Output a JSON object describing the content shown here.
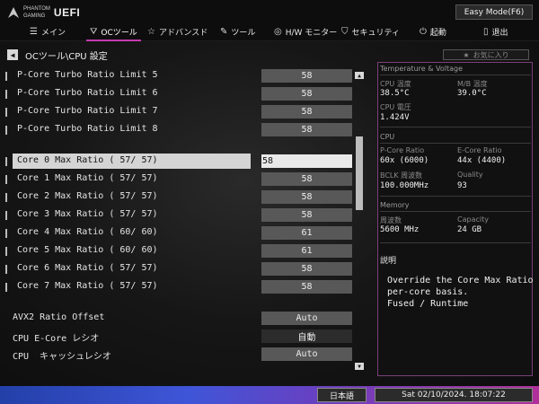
{
  "header": {
    "logo_line1": "PHANTOM",
    "logo_line2": "GAMING",
    "logo_uefi": "UEFI",
    "easy_mode": "Easy Mode(F6)"
  },
  "nav": [
    {
      "icon": "main-icon",
      "label": "メイン"
    },
    {
      "icon": "oc-icon",
      "label": "OCツール"
    },
    {
      "icon": "star-icon",
      "label": "アドバンスド"
    },
    {
      "icon": "tool-icon",
      "label": "ツール"
    },
    {
      "icon": "monitor-icon",
      "label": "H/W モニター"
    },
    {
      "icon": "shield-icon",
      "label": "セキュリティ"
    },
    {
      "icon": "power-icon",
      "label": "起動"
    },
    {
      "icon": "exit-icon",
      "label": "退出"
    }
  ],
  "breadcrumb": "OCツール\\CPU 設定",
  "favorite": "お気に入り",
  "settings": [
    {
      "label": "P-Core Turbo Ratio Limit 5",
      "value": "58"
    },
    {
      "label": "P-Core Turbo Ratio Limit 6",
      "value": "58"
    },
    {
      "label": "P-Core Turbo Ratio Limit 7",
      "value": "58"
    },
    {
      "label": "P-Core Turbo Ratio Limit 8",
      "value": "58"
    },
    {
      "label": "Core 0 Max Ratio ( 57/ 57)",
      "value": "58"
    },
    {
      "label": "Core 1 Max Ratio ( 57/ 57)",
      "value": "58"
    },
    {
      "label": "Core 2 Max Ratio ( 57/ 57)",
      "value": "58"
    },
    {
      "label": "Core 3 Max Ratio ( 57/ 57)",
      "value": "58"
    },
    {
      "label": "Core 4 Max Ratio ( 60/ 60)",
      "value": "61"
    },
    {
      "label": "Core 5 Max Ratio ( 60/ 60)",
      "value": "61"
    },
    {
      "label": "Core 6 Max Ratio ( 57/ 57)",
      "value": "58"
    },
    {
      "label": "Core 7 Max Ratio ( 57/ 57)",
      "value": "58"
    },
    {
      "label": "AVX2 Ratio Offset",
      "value": "Auto"
    },
    {
      "label": "CPU E-Core レシオ",
      "value": "自動"
    },
    {
      "label": "CPU  キャッシュレシオ",
      "value": "Auto"
    }
  ],
  "panel": {
    "section_temp": "Temperature & Voltage",
    "cpu_temp_label": "CPU 温度",
    "cpu_temp": "38.5°C",
    "mb_temp_label": "M/B 温度",
    "mb_temp": "39.0°C",
    "cpu_volt_label": "CPU 電圧",
    "cpu_volt": "1.424V",
    "section_cpu": "CPU",
    "pcore_label": "P-Core Ratio",
    "pcore": "60x (6000)",
    "ecore_label": "E-Core Ratio",
    "ecore": "44x (4400)",
    "bclk_label": "BCLK 周波数",
    "bclk": "100.000MHz",
    "quality_label": "Quality",
    "quality": "93",
    "section_mem": "Memory",
    "freq_label": "周波数",
    "freq": "5600 MHz",
    "cap_label": "Capacity",
    "cap": "24 GB",
    "desc_title": "説明",
    "desc_lines": [
      "Override the Core Max Ratio on",
      "per-core basis.",
      "Fused / Runtime"
    ]
  },
  "footer": {
    "language": "日本語",
    "datetime": "Sat 02/10/2024. 18:07:22"
  },
  "colors": {
    "accent": "#c43ab0",
    "panel_border": "#7b3f78"
  }
}
